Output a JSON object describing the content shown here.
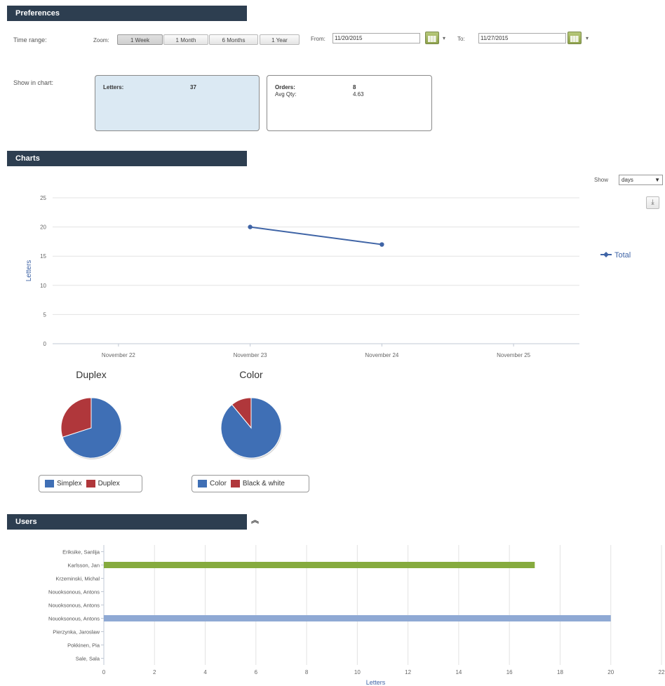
{
  "preferences": {
    "header": "Preferences",
    "time_range_label": "Time range:",
    "zoom_label": "Zoom:",
    "zoom_buttons": [
      "1 Week",
      "1 Month",
      "6 Months",
      "1 Year"
    ],
    "active_zoom": "1 Week",
    "from_label": "From:",
    "from_value": "11/20/2015",
    "to_label": "To:",
    "to_value": "11/27/2015",
    "show_in_chart_label": "Show in chart:",
    "letters_label": "Letters:",
    "letters_value": "37",
    "orders_label": "Orders:",
    "orders_value": "8",
    "avg_qty_label": "Avg Qty:",
    "avg_qty_value": "4.63"
  },
  "charts": {
    "header": "Charts",
    "show_label": "Show",
    "show_value": "days",
    "export_icon": "download-icon"
  },
  "users": {
    "header": "Users",
    "collapse_icon": "double-chevron-up-icon"
  },
  "colors": {
    "header_bg": "#2d3e50",
    "line": "#3f64a6",
    "pie_blue": "#3f6fb5",
    "pie_red": "#b0373b",
    "bar_green": "#86ab3e",
    "bar_blue": "#8fa9d4",
    "selected_box": "#dbe9f3"
  },
  "chart_data": [
    {
      "type": "line",
      "title": "",
      "ylabel": "Letters",
      "xlabel": "",
      "ylim": [
        0,
        25
      ],
      "yticks": [
        "0",
        "5",
        "10",
        "15",
        "20",
        "25"
      ],
      "categories": [
        "November 22",
        "November 23",
        "November 24",
        "November 25"
      ],
      "series": [
        {
          "name": "Total",
          "points": [
            {
              "x": "November 23",
              "y": 20
            },
            {
              "x": "November 24",
              "y": 17
            }
          ]
        }
      ],
      "legend": "right"
    },
    {
      "type": "pie",
      "title": "Duplex",
      "slices": [
        {
          "label": "Simplex",
          "value": 70
        },
        {
          "label": "Duplex",
          "value": 30
        }
      ],
      "legend": "bottom"
    },
    {
      "type": "pie",
      "title": "Color",
      "slices": [
        {
          "label": "Color",
          "value": 89
        },
        {
          "label": "Black & white",
          "value": 11
        }
      ],
      "legend": "bottom"
    },
    {
      "type": "bar",
      "orientation": "horizontal",
      "xlabel": "Letters",
      "xlim": [
        0,
        22
      ],
      "xticks": [
        "0",
        "2",
        "4",
        "6",
        "8",
        "10",
        "12",
        "14",
        "16",
        "18",
        "20",
        "22"
      ],
      "categories": [
        "Eriksike, Sanlija",
        "Karlsson, Jan",
        "Krzeminski, Michal",
        "Nouoksonous, Antons",
        "Nouoksonous, Antons",
        "Nouoksonous, Antons",
        "Pierzynka, Jaroslaw",
        "Pokkinen, Pia",
        "Sale, Sala"
      ],
      "values": [
        0,
        17,
        0,
        0,
        0,
        20,
        0,
        0,
        0
      ]
    }
  ]
}
